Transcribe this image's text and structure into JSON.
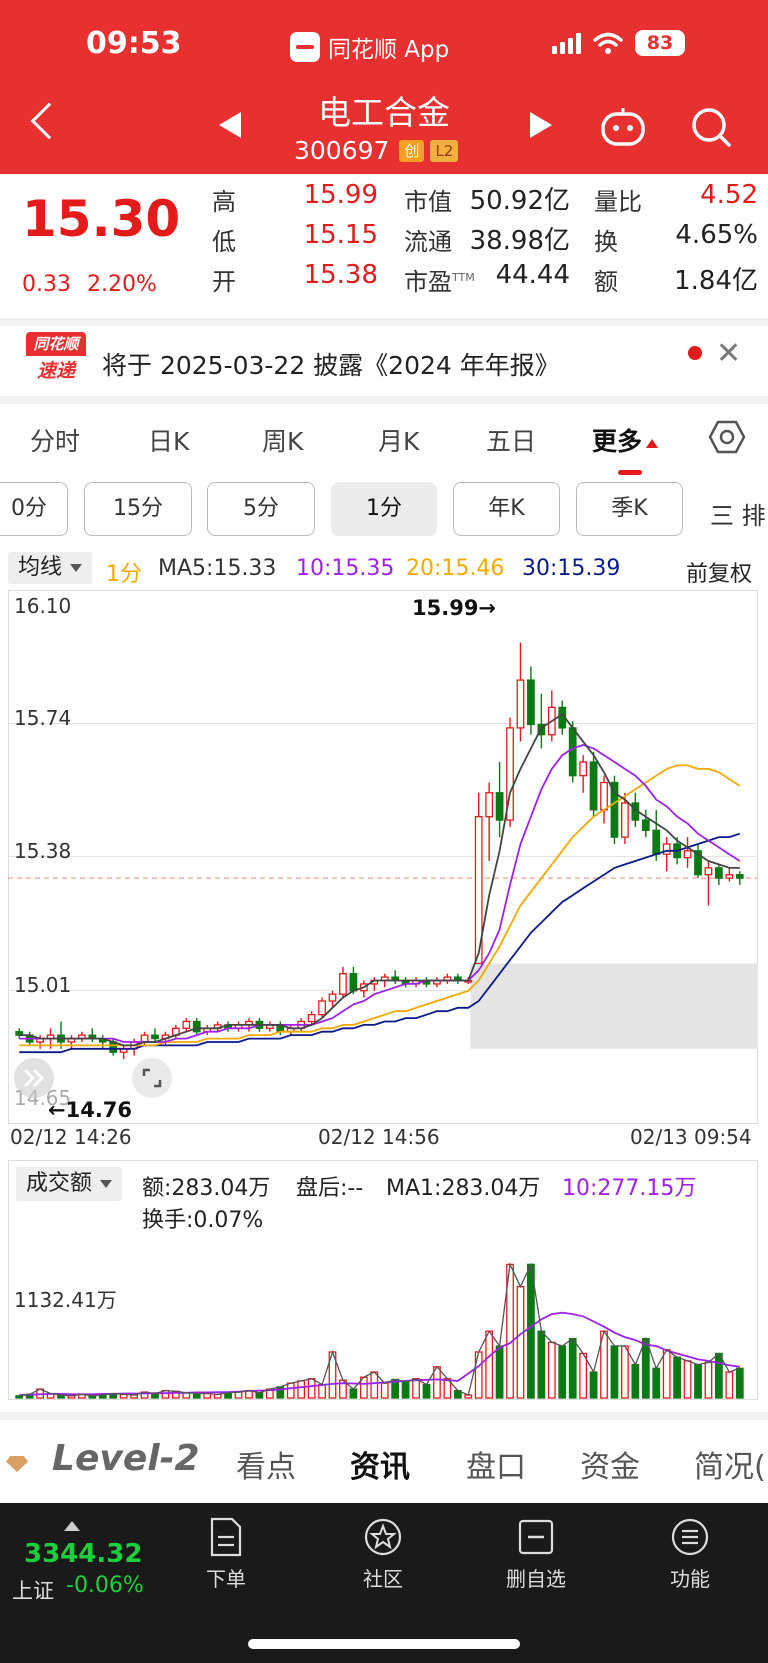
{
  "status": {
    "time": "09:53",
    "app": "同花顺 App",
    "battery": "83"
  },
  "header": {
    "name": "电工合金",
    "code": "300697",
    "tag1": "创",
    "tag2": "L2"
  },
  "quote": {
    "price": "15.30",
    "change": "0.33",
    "change_pct": "2.20%",
    "high_label": "高",
    "high": "15.99",
    "low_label": "低",
    "low": "15.15",
    "open_label": "开",
    "open": "15.38",
    "mcap_label": "市值",
    "mcap": "50.92亿",
    "float_label": "流通",
    "float": "38.98亿",
    "pe_label": "市盈",
    "pe_sup": "TTM",
    "pe": "44.44",
    "vr_label": "量比",
    "vr": "4.52",
    "turn_label": "换",
    "turn": "4.65%",
    "amt_label": "额",
    "amt": "1.84亿"
  },
  "notice": {
    "logo1": "同花顺",
    "logo2": "速递",
    "text": "将于 2025-03-22 披露《2024 年年报》"
  },
  "tabs": [
    "分时",
    "日K",
    "周K",
    "月K",
    "五日",
    "更多"
  ],
  "sub_tabs": [
    "0分",
    "15分",
    "5分",
    "1分",
    "年K",
    "季K"
  ],
  "sub_menu": "三 排",
  "indicators": {
    "ma_select": "均线",
    "period": "1分",
    "ma5": "MA5:15.33",
    "ma10": "10:15.35",
    "ma20": "20:15.46",
    "ma30": "30:15.39",
    "adjust": "前复权"
  },
  "colors": {
    "up": "#e31b1b",
    "down": "#0b7a12",
    "ma5": "#444444",
    "ma10": "#a020f0",
    "ma20": "#f5a800",
    "ma30": "#0b1a8a"
  },
  "chart_data": {
    "type": "candlestick",
    "y_ticks": [
      "16.10",
      "15.74",
      "15.38",
      "15.01",
      "14.65"
    ],
    "ylim": [
      14.65,
      16.1
    ],
    "x_ticks": [
      "02/12 14:26",
      "02/12 14:56",
      "02/13 09:54"
    ],
    "high_annotation": "15.99→",
    "low_annotation": "←14.76",
    "ref_price": 15.3,
    "candles": [
      [
        14.85,
        14.86,
        14.83,
        14.84
      ],
      [
        14.84,
        14.85,
        14.81,
        14.82
      ],
      [
        14.82,
        14.84,
        14.8,
        14.83
      ],
      [
        14.83,
        14.86,
        14.8,
        14.84
      ],
      [
        14.84,
        14.88,
        14.8,
        14.82
      ],
      [
        14.82,
        14.84,
        14.8,
        14.83
      ],
      [
        14.83,
        14.85,
        14.82,
        14.84
      ],
      [
        14.84,
        14.86,
        14.82,
        14.83
      ],
      [
        14.83,
        14.84,
        14.8,
        14.82
      ],
      [
        14.82,
        14.83,
        14.78,
        14.79
      ],
      [
        14.79,
        14.81,
        14.77,
        14.8
      ],
      [
        14.8,
        14.83,
        14.78,
        14.82
      ],
      [
        14.82,
        14.85,
        14.81,
        14.84
      ],
      [
        14.84,
        14.86,
        14.82,
        14.83
      ],
      [
        14.83,
        14.85,
        14.81,
        14.84
      ],
      [
        14.84,
        14.87,
        14.83,
        14.86
      ],
      [
        14.86,
        14.89,
        14.85,
        14.88
      ],
      [
        14.88,
        14.89,
        14.84,
        14.85
      ],
      [
        14.85,
        14.87,
        14.84,
        14.86
      ],
      [
        14.86,
        14.88,
        14.85,
        14.87
      ],
      [
        14.87,
        14.88,
        14.85,
        14.86
      ],
      [
        14.86,
        14.88,
        14.85,
        14.87
      ],
      [
        14.87,
        14.89,
        14.85,
        14.88
      ],
      [
        14.88,
        14.89,
        14.85,
        14.86
      ],
      [
        14.86,
        14.88,
        14.85,
        14.87
      ],
      [
        14.87,
        14.88,
        14.84,
        14.85
      ],
      [
        14.85,
        14.87,
        14.84,
        14.86
      ],
      [
        14.86,
        14.89,
        14.85,
        14.88
      ],
      [
        14.88,
        14.91,
        14.87,
        14.9
      ],
      [
        14.9,
        14.95,
        14.89,
        14.94
      ],
      [
        14.94,
        14.97,
        14.92,
        14.96
      ],
      [
        14.96,
        15.04,
        14.95,
        15.02
      ],
      [
        15.02,
        15.04,
        14.96,
        14.97
      ],
      [
        14.97,
        15.0,
        14.95,
        14.99
      ],
      [
        14.99,
        15.01,
        14.97,
        15.0
      ],
      [
        15.0,
        15.02,
        14.98,
        15.01
      ],
      [
        15.01,
        15.03,
        14.99,
        15.0
      ],
      [
        15.0,
        15.01,
        14.98,
        14.99
      ],
      [
        14.99,
        15.01,
        14.98,
        15.0
      ],
      [
        15.0,
        15.01,
        14.98,
        14.99
      ],
      [
        14.99,
        15.01,
        14.98,
        15.0
      ],
      [
        15.0,
        15.02,
        14.99,
        15.01
      ],
      [
        15.01,
        15.02,
        14.99,
        15.0
      ],
      [
        15.0,
        15.01,
        14.99,
        15.0
      ],
      [
        15.05,
        15.55,
        15.1,
        15.48
      ],
      [
        15.48,
        15.58,
        15.35,
        15.55
      ],
      [
        15.55,
        15.64,
        15.42,
        15.47
      ],
      [
        15.47,
        15.77,
        15.45,
        15.74
      ],
      [
        15.74,
        15.99,
        15.7,
        15.88
      ],
      [
        15.88,
        15.92,
        15.72,
        15.75
      ],
      [
        15.75,
        15.84,
        15.68,
        15.72
      ],
      [
        15.72,
        15.85,
        15.7,
        15.8
      ],
      [
        15.8,
        15.82,
        15.72,
        15.74
      ],
      [
        15.74,
        15.76,
        15.58,
        15.6
      ],
      [
        15.6,
        15.66,
        15.55,
        15.64
      ],
      [
        15.64,
        15.67,
        15.48,
        15.5
      ],
      [
        15.5,
        15.6,
        15.46,
        15.58
      ],
      [
        15.58,
        15.6,
        15.4,
        15.42
      ],
      [
        15.42,
        15.55,
        15.4,
        15.52
      ],
      [
        15.52,
        15.55,
        15.45,
        15.47
      ],
      [
        15.47,
        15.5,
        15.42,
        15.44
      ],
      [
        15.44,
        15.5,
        15.35,
        15.37
      ],
      [
        15.37,
        15.42,
        15.32,
        15.4
      ],
      [
        15.4,
        15.42,
        15.34,
        15.36
      ],
      [
        15.36,
        15.42,
        15.33,
        15.38
      ],
      [
        15.38,
        15.4,
        15.3,
        15.31
      ],
      [
        15.31,
        15.35,
        15.22,
        15.33
      ],
      [
        15.33,
        15.34,
        15.28,
        15.3
      ],
      [
        15.3,
        15.33,
        15.29,
        15.31
      ],
      [
        15.31,
        15.32,
        15.28,
        15.3
      ]
    ],
    "ma": {
      "ma5": [
        14.84,
        14.84,
        14.83,
        14.83,
        14.83,
        14.83,
        14.83,
        14.83,
        14.83,
        14.82,
        14.81,
        14.81,
        14.82,
        14.82,
        14.83,
        14.84,
        14.85,
        14.86,
        14.86,
        14.86,
        14.87,
        14.87,
        14.87,
        14.87,
        14.87,
        14.87,
        14.86,
        14.86,
        14.87,
        14.89,
        14.92,
        14.95,
        14.97,
        14.98,
        15.0,
        15.0,
        15.0,
        15.0,
        15.0,
        15.0,
        15.0,
        15.0,
        15.0,
        15.0,
        15.08,
        15.25,
        15.38,
        15.55,
        15.62,
        15.68,
        15.74,
        15.76,
        15.78,
        15.74,
        15.7,
        15.66,
        15.61,
        15.55,
        15.53,
        15.5,
        15.48,
        15.46,
        15.44,
        15.41,
        15.39,
        15.37,
        15.35,
        15.34,
        15.33,
        15.33
      ],
      "ma10": [
        14.83,
        14.83,
        14.83,
        14.83,
        14.83,
        14.83,
        14.83,
        14.83,
        14.83,
        14.83,
        14.82,
        14.82,
        14.82,
        14.82,
        14.82,
        14.83,
        14.83,
        14.84,
        14.85,
        14.85,
        14.86,
        14.86,
        14.86,
        14.87,
        14.87,
        14.87,
        14.87,
        14.87,
        14.87,
        14.88,
        14.89,
        14.91,
        14.93,
        14.94,
        14.96,
        14.97,
        14.98,
        14.99,
        14.99,
        15.0,
        15.0,
        15.0,
        15.0,
        15.0,
        15.03,
        15.08,
        15.15,
        15.28,
        15.4,
        15.48,
        15.56,
        15.62,
        15.66,
        15.68,
        15.69,
        15.68,
        15.66,
        15.64,
        15.62,
        15.6,
        15.57,
        15.53,
        15.51,
        15.48,
        15.46,
        15.43,
        15.41,
        15.39,
        15.37,
        15.35
      ],
      "ma20": [
        14.81,
        14.81,
        14.81,
        14.81,
        14.81,
        14.81,
        14.81,
        14.81,
        14.81,
        14.81,
        14.81,
        14.81,
        14.81,
        14.81,
        14.82,
        14.82,
        14.82,
        14.82,
        14.83,
        14.83,
        14.83,
        14.83,
        14.84,
        14.84,
        14.84,
        14.85,
        14.85,
        14.85,
        14.85,
        14.86,
        14.86,
        14.87,
        14.87,
        14.88,
        14.89,
        14.9,
        14.91,
        14.91,
        14.92,
        14.93,
        14.94,
        14.95,
        14.96,
        14.97,
        15.0,
        15.05,
        15.1,
        15.16,
        15.22,
        15.26,
        15.3,
        15.34,
        15.38,
        15.42,
        15.45,
        15.48,
        15.5,
        15.52,
        15.54,
        15.56,
        15.58,
        15.6,
        15.62,
        15.63,
        15.63,
        15.62,
        15.62,
        15.61,
        15.59,
        15.57
      ],
      "ma30": [
        14.79,
        14.79,
        14.79,
        14.79,
        14.79,
        14.8,
        14.8,
        14.8,
        14.8,
        14.8,
        14.8,
        14.8,
        14.81,
        14.81,
        14.81,
        14.81,
        14.81,
        14.81,
        14.82,
        14.82,
        14.82,
        14.82,
        14.83,
        14.83,
        14.83,
        14.83,
        14.84,
        14.84,
        14.84,
        14.85,
        14.85,
        14.86,
        14.86,
        14.87,
        14.87,
        14.88,
        14.88,
        14.89,
        14.89,
        14.9,
        14.91,
        14.91,
        14.92,
        14.92,
        14.94,
        14.98,
        15.02,
        15.06,
        15.1,
        15.14,
        15.17,
        15.2,
        15.23,
        15.25,
        15.27,
        15.29,
        15.31,
        15.33,
        15.34,
        15.35,
        15.36,
        15.37,
        15.38,
        15.38,
        15.39,
        15.4,
        15.41,
        15.42,
        15.42,
        15.43
      ]
    },
    "volume": {
      "label": "1132.41万",
      "ylim": [
        0,
        2600
      ],
      "values": [
        30,
        50,
        120,
        60,
        40,
        30,
        50,
        30,
        40,
        60,
        50,
        40,
        80,
        60,
        100,
        90,
        70,
        60,
        60,
        50,
        70,
        80,
        100,
        70,
        120,
        150,
        200,
        230,
        260,
        180,
        620,
        240,
        120,
        280,
        350,
        200,
        250,
        220,
        260,
        180,
        420,
        260,
        100,
        40,
        620,
        900,
        700,
        1800,
        1500,
        1800,
        900,
        750,
        700,
        800,
        600,
        350,
        900,
        700,
        700,
        450,
        800,
        400,
        650,
        550,
        500,
        450,
        480,
        600,
        350,
        400
      ],
      "ma1": [
        40,
        45,
        50,
        55,
        55,
        50,
        50,
        50,
        55,
        55,
        60,
        60,
        60,
        65,
        65,
        70,
        70,
        75,
        75,
        80,
        80,
        85,
        95,
        100,
        105,
        115,
        130,
        145,
        160,
        175,
        190,
        200,
        195,
        190,
        200,
        210,
        220,
        230,
        240,
        245,
        250,
        240,
        230,
        330,
        430,
        560,
        680,
        740,
        860,
        960,
        1060,
        1130,
        1150,
        1130,
        1100,
        1030,
        960,
        880,
        820,
        780,
        720,
        700,
        640,
        600,
        560,
        520,
        500,
        470,
        440,
        420
      ]
    }
  },
  "volume_panel": {
    "select": "成交额",
    "amount": "额:283.04万",
    "after": "盘后:--",
    "ma1": "MA1:283.04万",
    "ma10": "10:277.15万",
    "turnover": "换手:0.07%"
  },
  "info_tabs": {
    "level2": "Level-2",
    "items": [
      "看点",
      "资讯",
      "盘口",
      "资金",
      "简况("
    ]
  },
  "bottom": {
    "index_value": "3344.32",
    "index_name": "上证",
    "index_change": "-0.06%",
    "items": [
      "下单",
      "社区",
      "删自选",
      "功能"
    ]
  }
}
